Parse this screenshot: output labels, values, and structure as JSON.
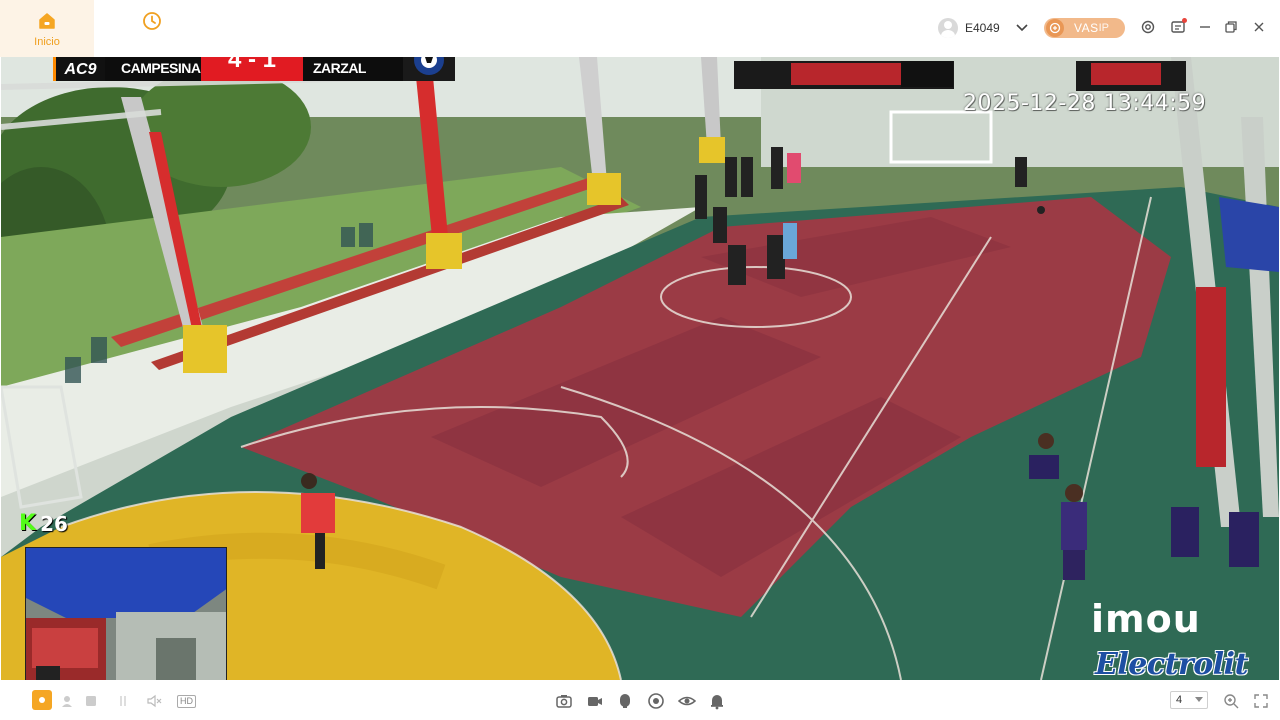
{
  "nav": {
    "home_label": "Inicio",
    "history_label": ""
  },
  "header": {
    "user_id": "E4049",
    "vas_label": "VAS",
    "vas_sub": "IP"
  },
  "video": {
    "timestamp": "2025-12-28 13:44:59",
    "scoreboard": {
      "logo_text": "AC9",
      "home_team": "P CAMPESINA",
      "score": "4 - 1",
      "away_team": "LA PAVA ZARZAL"
    },
    "kick_counter": {
      "icon": "K",
      "viewers": "26"
    },
    "brand_top": "imou",
    "brand_bottom": "Electrolit"
  },
  "toolbar": {
    "quality_label": "HD",
    "layout_value": "4"
  },
  "colors": {
    "accent_orange": "#f0a020",
    "score_red": "#e11b22",
    "kick_green": "#53fc18",
    "electrolit_blue": "#1d4fa3",
    "court_red": "#9b3b45",
    "court_green": "#2f6a55",
    "court_yellow": "#e0b526"
  }
}
